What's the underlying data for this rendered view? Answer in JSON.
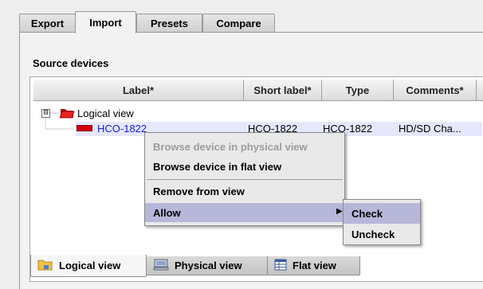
{
  "tabs": [
    {
      "label": "Export",
      "active": false
    },
    {
      "label": "Import",
      "active": true
    },
    {
      "label": "Presets",
      "active": false
    },
    {
      "label": "Compare",
      "active": false
    }
  ],
  "section": {
    "title": "Source devices"
  },
  "columns": [
    "Label*",
    "Short label*",
    "Type",
    "Comments*"
  ],
  "tree": {
    "root": {
      "label": "Logical view",
      "expander": "⊟"
    },
    "device": {
      "label": "HCO-1822",
      "short_label": "HCO-1822",
      "type": "HCO-1822",
      "comments": "HD/SD Cha..."
    }
  },
  "context_menu": {
    "items": [
      {
        "label": "Browse device in physical view",
        "enabled": false
      },
      {
        "label": "Browse device in flat view",
        "enabled": true
      },
      {
        "label": "Remove from view",
        "enabled": true
      },
      {
        "label": "Allow",
        "enabled": true,
        "highlighted": true,
        "submenu_arrow": "▶"
      }
    ],
    "submenu": [
      {
        "label": "Check",
        "highlighted": true
      },
      {
        "label": "Uncheck",
        "highlighted": false
      }
    ]
  },
  "bottom_tabs": [
    {
      "label": "Logical view",
      "icon": "folder-icon",
      "active": true
    },
    {
      "label": "Physical view",
      "icon": "physical-device-icon",
      "active": false
    },
    {
      "label": "Flat view",
      "icon": "table-icon",
      "active": false
    }
  ],
  "colors": {
    "folder_red": "#d81010",
    "device_red": "#d40000",
    "device_link": "#1a1ae8",
    "highlight": "#b7b7da",
    "selected_row": "#e5e8fc"
  }
}
